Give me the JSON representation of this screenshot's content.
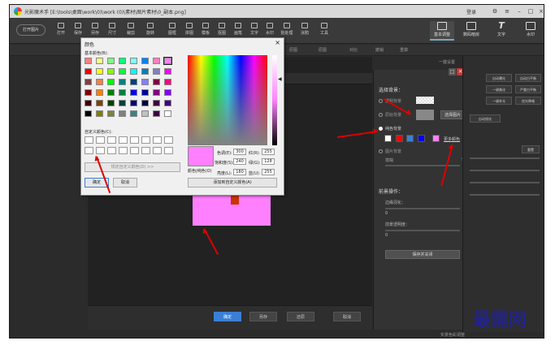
{
  "app": {
    "title": "光影魔术手 [E:\\tools\\桌面\\work\\0)\\work (0)\\素材\\图片素材\\0_副本.png]",
    "user": "登录"
  },
  "toolbar": {
    "open_label": "打开图片",
    "buttons": [
      "打开",
      "保存",
      "另存",
      "尺寸",
      "裁剪",
      "旋转",
      "图框",
      "拼图",
      "模板",
      "抠图",
      "画笔",
      "文字",
      "水印",
      "批处理",
      "涂鸦",
      "工具"
    ],
    "tabs": [
      "基本调整",
      "数码暗房",
      "文字",
      "水印"
    ]
  },
  "subbar": {
    "items": [
      "原图",
      "原图",
      "对比",
      "撤销",
      "重做",
      "一键设置"
    ]
  },
  "color_dialog": {
    "title": "颜色",
    "basic_label": "基本颜色(B):",
    "custom_label": "自定义颜色(C):",
    "define_button": "规定自定义颜色(D) >>",
    "ok": "确定",
    "cancel": "取消",
    "hue_label": "色调(E):",
    "hue": "300",
    "sat_label": "饱和度(S):",
    "sat": "240",
    "lum_label": "亮度(L):",
    "lum": "180",
    "red_label": "红(R):",
    "red": "255",
    "green_label": "绿(G):",
    "green": "128",
    "blue_label": "蓝(U):",
    "blue": "255",
    "colorsolid_label": "颜色|纯色(O)",
    "add_button": "添加到自定义颜色(A)",
    "basic_colors": [
      "#ff8080",
      "#ffff80",
      "#80ff80",
      "#00ff80",
      "#80ffff",
      "#0080ff",
      "#ff80c0",
      "#ff80ff",
      "#ff0000",
      "#ffff00",
      "#80ff00",
      "#00ff40",
      "#00ffff",
      "#0080c0",
      "#8080c0",
      "#ff00ff",
      "#804040",
      "#ff8040",
      "#00ff00",
      "#008080",
      "#004080",
      "#8080ff",
      "#800040",
      "#ff0080",
      "#800000",
      "#ff8000",
      "#008000",
      "#008040",
      "#0000ff",
      "#0000a0",
      "#800080",
      "#8000ff",
      "#400000",
      "#804000",
      "#004000",
      "#004040",
      "#000080",
      "#000040",
      "#400040",
      "#400080",
      "#000000",
      "#808000",
      "#808040",
      "#808080",
      "#408080",
      "#c0c0c0",
      "#400040",
      "#ffffff"
    ]
  },
  "bg_panel": {
    "title": "选择背景：",
    "opt_transparent": "透明背景",
    "opt_original": "原始背景",
    "opt_solid": "纯色背景",
    "opt_image": "图片背景",
    "select_image": "选择图片",
    "more_colors": "更多颜色",
    "blur_label": "模糊",
    "blur_value": "5",
    "fg_ops": "前景操作：",
    "edge_label": "边缘羽化：",
    "edge_value": "0",
    "opacity_label": "前景透明度：",
    "opacity_value": "0",
    "save_btn": "保存并关闭",
    "swatches": [
      "#ffffff",
      "#ff0000",
      "#3a7fd5",
      "#0000ff",
      "#ff80ff"
    ]
  },
  "right_panel": {
    "buttons": [
      "自动曝光",
      "自动白平衡",
      "一键美化",
      "严重白平衡",
      "一键补光",
      "逆光降噪",
      "自动锐化",
      "一键填充"
    ],
    "reset": "重置"
  },
  "bottom_bar": {
    "buttons": [
      "确定",
      "另存",
      "还原",
      "取消"
    ]
  },
  "status": {
    "bottom_right": "实景色彩调整"
  },
  "watermark": "最需网"
}
